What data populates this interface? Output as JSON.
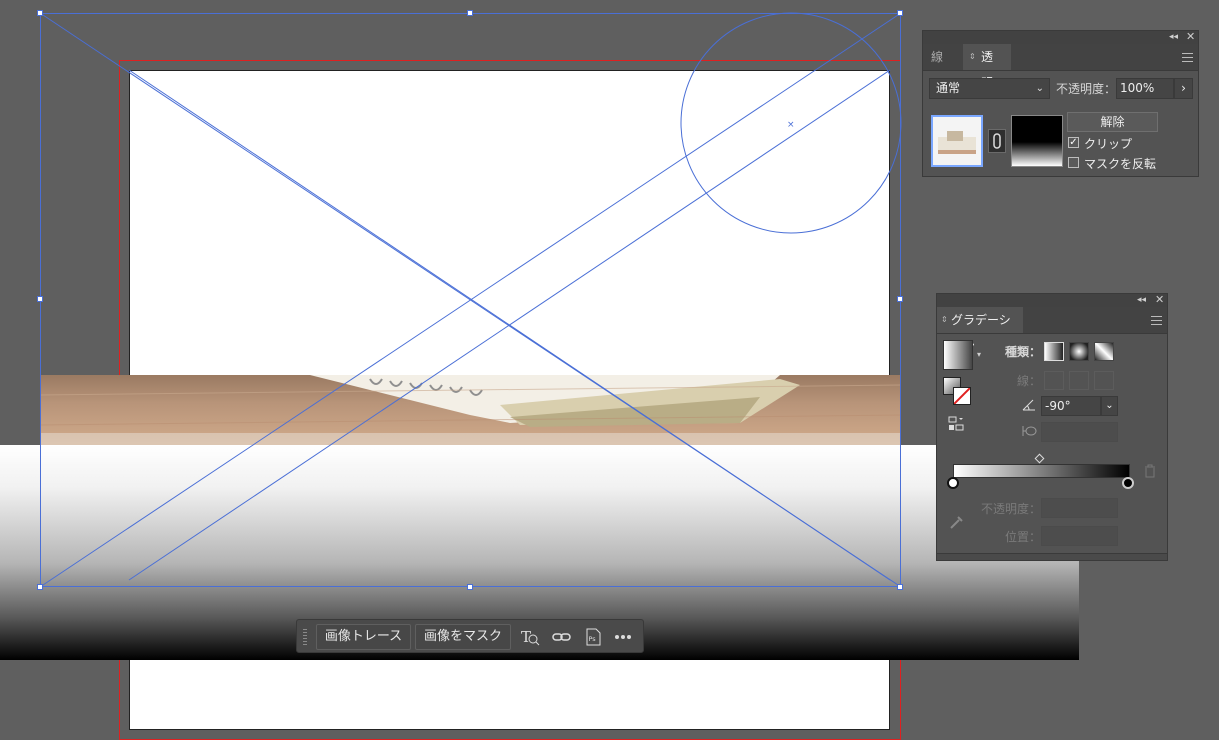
{
  "transparency_panel": {
    "tabs": [
      {
        "label": "線"
      },
      {
        "label": "透明"
      }
    ],
    "blend_mode": "通常",
    "opacity_label": "不透明度：",
    "opacity_value": "100%",
    "release_button": "解除",
    "clip_label": "クリップ",
    "clip_checked": true,
    "invert_mask_label": "マスクを反転",
    "invert_mask_checked": false
  },
  "gradient_panel": {
    "tab_label": "グラデーション",
    "type_label": "種類：",
    "stroke_label": "線：",
    "angle_value": "-90°",
    "opacity_label": "不透明度：",
    "location_label": "位置："
  },
  "context_toolbar": {
    "trace_button": "画像トレース",
    "mask_button": "画像をマスク",
    "more_icon": "more-icon"
  },
  "colors": {
    "selection": "#4a6fd6",
    "bleed_guide": "#e02020",
    "panel_bg": "#535353",
    "canvas_bg": "#5f5f5f"
  }
}
